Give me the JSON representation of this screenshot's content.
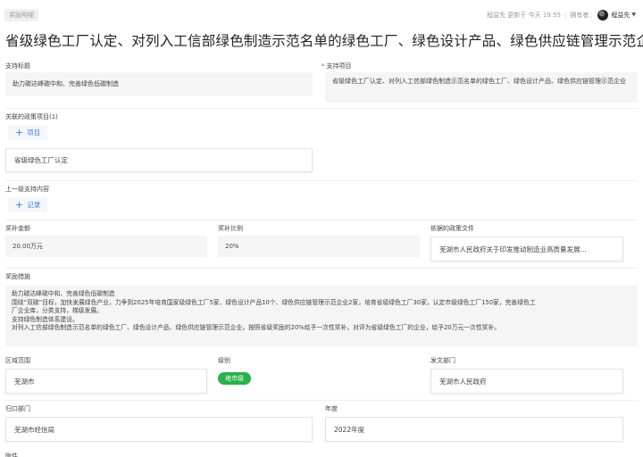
{
  "breadcrumb": "奖励明细",
  "meta": {
    "updated": "程益先 更新于 今天 19:55",
    "owner_prefix": "拥有者：",
    "owner": "程益先"
  },
  "title": "省级绿色工厂认定、对列入工信部绿色制造示范名单的绿色工厂、绿色设计产品、绿色供应链管理示范企业",
  "support_title": {
    "label": "支持标题",
    "value": "助力碳达峰碳中和、完善绿色低碳制造"
  },
  "support_project": {
    "label": "支持项目",
    "value": "省级绿色工厂认定、对列入工信部绿色制造示范名单的绿色工厂、绿色设计产品、绿色供应链管理示范企业"
  },
  "related_policy": {
    "label": "关联的政策项目(1)",
    "add_label": "项目",
    "item": "省级绿色工厂认定"
  },
  "parent_support": {
    "label": "上一级支持内容",
    "add_label": "记录"
  },
  "award_amount": {
    "label": "奖补金额",
    "value": "20.00万元"
  },
  "award_ratio": {
    "label": "奖补比例",
    "value": "20%"
  },
  "policy_document": {
    "label": "依据的政策文件",
    "value": "芜湖市人民政府关于印发推动制造业高质量发展..."
  },
  "measures": {
    "label": "奖励措施",
    "lines": [
      "助力碳达峰碳中和、完善绿色低碳制造",
      "围绕“双碳”目标，加快发展绿色产业，力争到2025年培育国家级绿色工厂5家、绿色设计产品10个、绿色供应链管理示范企业2家，培育省级绿色工厂30家，认定市级绿色工厂150家，完善绿色工",
      "厂企业库，分类支持，梯级发展。",
      "支持绿色制造体系建设。",
      "对列入工信部绿色制造示范名单的绿色工厂、绿色设计产品、绿色供应链管理示范企业，按照省级奖励的20%给予一次性奖补。对评为省级绿色工厂的企业，给予20万元一次性奖补。"
    ]
  },
  "region": {
    "label": "区域范围",
    "value": "芜湖市"
  },
  "level": {
    "label": "级别",
    "value": "地市级",
    "color": "#27b24a"
  },
  "issuing_dept": {
    "label": "发文部门",
    "value": "芜湖市人民政府"
  },
  "belong_dept": {
    "label": "归口部门",
    "value": "芜湖市经信局"
  },
  "year": {
    "label": "年度",
    "value": "2022年度"
  },
  "attachments": {
    "label": "附件"
  }
}
